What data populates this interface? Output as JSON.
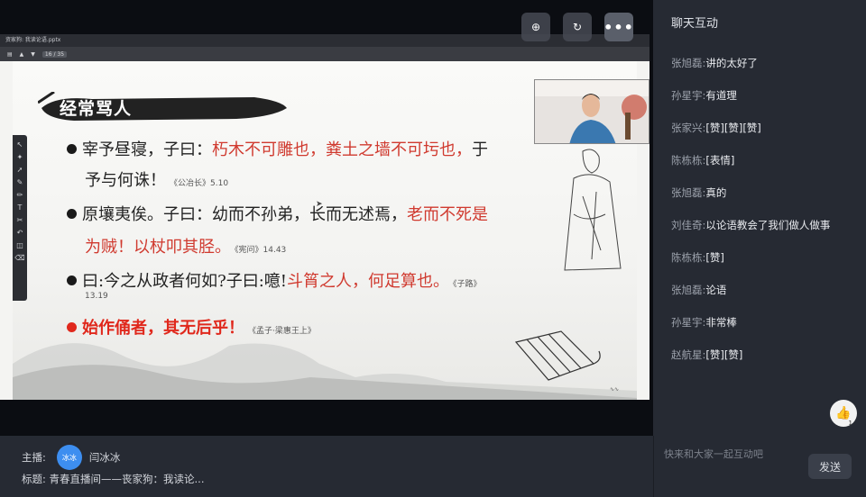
{
  "video": {
    "top_controls": [
      {
        "icon": "screen-share-icon",
        "glyph": "⊕"
      },
      {
        "icon": "rotate-icon",
        "glyph": "↻"
      },
      {
        "icon": "more-icon",
        "glyph": "•••"
      }
    ]
  },
  "ppt": {
    "window_title": "资家狗: 我读论语.pptx",
    "page_indicator": "16 / 35"
  },
  "slide": {
    "title": "经常骂人",
    "lines": [
      {
        "black": "宰予昼寝，子曰：",
        "red": "朽木不可雕也，粪土之墙不可圬也，",
        "tail": "于"
      },
      {
        "black": "予与何诛！",
        "source": "《公冶长》5.10"
      },
      {
        "black": "原壤夷俟。子曰：",
        "red_serif": "幼而不孙弟，长而无述焉，",
        "red": "老而不死是"
      },
      {
        "red": "为贼！以杖叩其胫。",
        "source": "《宪问》14.43"
      },
      {
        "black": "曰:今之从政者何如?子曰:噫!",
        "red": "斗筲之人，何足算也。",
        "source": "《子路》"
      },
      {
        "source": "13.19"
      },
      {
        "bright_red": "始作俑者，其无后乎！",
        "source": "《孟子·梁惠王上》"
      }
    ]
  },
  "chat": {
    "title": "聊天互动",
    "messages": [
      {
        "user": "张旭磊:",
        "text": "讲的太好了"
      },
      {
        "user": "孙星宇:",
        "text": "有道理"
      },
      {
        "user": "张家兴:",
        "text": "[赞][赞][赞]"
      },
      {
        "user": "陈栋栋:",
        "text": "[表情]"
      },
      {
        "user": "张旭磊:",
        "text": "真的"
      },
      {
        "user": "刘佳奇:",
        "text": "以论语教会了我们做人做事"
      },
      {
        "user": "陈栋栋:",
        "text": "[赞]"
      },
      {
        "user": "张旭磊:",
        "text": "论语"
      },
      {
        "user": "孙星宇:",
        "text": "非常棒"
      },
      {
        "user": "赵航星:",
        "text": "[赞][赞]"
      }
    ],
    "like_count": "1",
    "input_placeholder": "快来和大家一起互动吧",
    "send_label": "发送"
  },
  "footer": {
    "host_label": "主播:",
    "host_avatar_text": "冰冰",
    "host_name": "闫冰冰",
    "subject_label": "标题:",
    "subject": "青春直播间——丧家狗：我读论..."
  },
  "colors": {
    "panel_bg": "#262a33",
    "accent_blue": "#3d8ef0",
    "slide_red": "#d03a2f",
    "bright_red": "#e0281c"
  }
}
